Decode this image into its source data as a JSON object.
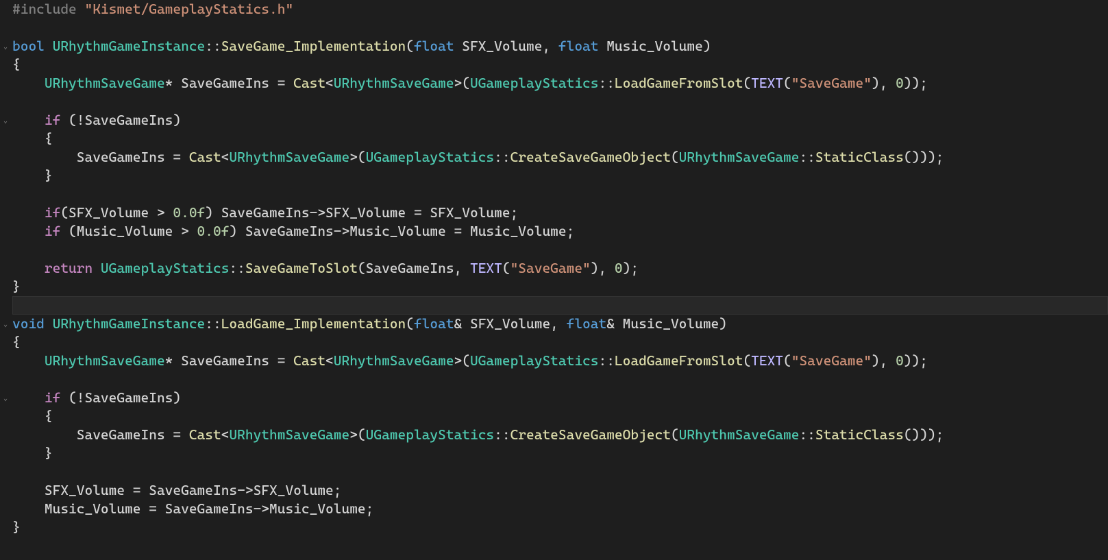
{
  "fold_marks": [
    {
      "line": 2,
      "glyph": "⌄"
    },
    {
      "line": 7,
      "glyph": "⌄"
    },
    {
      "line": 17,
      "glyph": "⌄"
    },
    {
      "line": 21,
      "glyph": "⌄"
    }
  ],
  "lines": [
    {
      "n": 1,
      "hl": false,
      "tokens": [
        [
          "d",
          "#include "
        ],
        [
          "s",
          "\"Kismet/GameplayStatics.h\""
        ]
      ]
    },
    {
      "n": 2,
      "hl": false,
      "tokens": [
        [
          "c",
          ""
        ]
      ]
    },
    {
      "n": 3,
      "hl": false,
      "tokens": [
        [
          "k",
          "bool "
        ],
        [
          "t",
          "URhythmGameInstance"
        ],
        [
          "p",
          "::"
        ],
        [
          "f",
          "SaveGame_Implementation"
        ],
        [
          "p",
          "("
        ],
        [
          "k",
          "float"
        ],
        [
          "c",
          " SFX_Volume"
        ],
        [
          "p",
          ", "
        ],
        [
          "k",
          "float"
        ],
        [
          "c",
          " Music_Volume"
        ],
        [
          "p",
          ")"
        ]
      ]
    },
    {
      "n": 4,
      "hl": false,
      "tokens": [
        [
          "p",
          "{"
        ]
      ]
    },
    {
      "n": 5,
      "hl": false,
      "tokens": [
        [
          "c",
          "    "
        ],
        [
          "t",
          "URhythmSaveGame"
        ],
        [
          "p",
          "* "
        ],
        [
          "c",
          "SaveGameIns "
        ],
        [
          "op",
          "= "
        ],
        [
          "f",
          "Cast"
        ],
        [
          "p",
          "<"
        ],
        [
          "t",
          "URhythmSaveGame"
        ],
        [
          "p",
          ">("
        ],
        [
          "t",
          "UGameplayStatics"
        ],
        [
          "p",
          "::"
        ],
        [
          "f",
          "LoadGameFromSlot"
        ],
        [
          "p",
          "("
        ],
        [
          "mac",
          "TEXT"
        ],
        [
          "p",
          "("
        ],
        [
          "s",
          "\"SaveGame\""
        ],
        [
          "p",
          "), "
        ],
        [
          "n",
          "0"
        ],
        [
          "p",
          "));"
        ]
      ]
    },
    {
      "n": 6,
      "hl": false,
      "tokens": [
        [
          "c",
          ""
        ]
      ]
    },
    {
      "n": 7,
      "hl": false,
      "tokens": [
        [
          "c",
          "    "
        ],
        [
          "m",
          "if"
        ],
        [
          "c",
          " "
        ],
        [
          "p",
          "(!"
        ],
        [
          "c",
          "SaveGameIns"
        ],
        [
          "p",
          ")"
        ]
      ]
    },
    {
      "n": 8,
      "hl": false,
      "tokens": [
        [
          "c",
          "    "
        ],
        [
          "p",
          "{"
        ]
      ]
    },
    {
      "n": 9,
      "hl": false,
      "tokens": [
        [
          "c",
          "        SaveGameIns "
        ],
        [
          "op",
          "= "
        ],
        [
          "f",
          "Cast"
        ],
        [
          "p",
          "<"
        ],
        [
          "t",
          "URhythmSaveGame"
        ],
        [
          "p",
          ">("
        ],
        [
          "t",
          "UGameplayStatics"
        ],
        [
          "p",
          "::"
        ],
        [
          "f",
          "CreateSaveGameObject"
        ],
        [
          "p",
          "("
        ],
        [
          "t",
          "URhythmSaveGame"
        ],
        [
          "p",
          "::"
        ],
        [
          "f",
          "StaticClass"
        ],
        [
          "p",
          "()));"
        ]
      ]
    },
    {
      "n": 10,
      "hl": false,
      "tokens": [
        [
          "c",
          "    "
        ],
        [
          "p",
          "}"
        ]
      ]
    },
    {
      "n": 11,
      "hl": false,
      "tokens": [
        [
          "c",
          ""
        ]
      ]
    },
    {
      "n": 12,
      "hl": false,
      "tokens": [
        [
          "c",
          "    "
        ],
        [
          "m",
          "if"
        ],
        [
          "p",
          "("
        ],
        [
          "c",
          "SFX_Volume "
        ],
        [
          "op",
          "> "
        ],
        [
          "n",
          "0.0f"
        ],
        [
          "p",
          ") "
        ],
        [
          "c",
          "SaveGameIns"
        ],
        [
          "op",
          "->"
        ],
        [
          "c",
          "SFX_Volume "
        ],
        [
          "op",
          "= "
        ],
        [
          "c",
          "SFX_Volume"
        ],
        [
          "p",
          ";"
        ]
      ]
    },
    {
      "n": 13,
      "hl": false,
      "tokens": [
        [
          "c",
          "    "
        ],
        [
          "m",
          "if"
        ],
        [
          "c",
          " "
        ],
        [
          "p",
          "("
        ],
        [
          "c",
          "Music_Volume "
        ],
        [
          "op",
          "> "
        ],
        [
          "n",
          "0.0f"
        ],
        [
          "p",
          ") "
        ],
        [
          "c",
          "SaveGameIns"
        ],
        [
          "op",
          "->"
        ],
        [
          "c",
          "Music_Volume "
        ],
        [
          "op",
          "= "
        ],
        [
          "c",
          "Music_Volume"
        ],
        [
          "p",
          ";"
        ]
      ]
    },
    {
      "n": 14,
      "hl": false,
      "tokens": [
        [
          "c",
          ""
        ]
      ]
    },
    {
      "n": 15,
      "hl": false,
      "tokens": [
        [
          "c",
          "    "
        ],
        [
          "m",
          "return"
        ],
        [
          "c",
          " "
        ],
        [
          "t",
          "UGameplayStatics"
        ],
        [
          "p",
          "::"
        ],
        [
          "f",
          "SaveGameToSlot"
        ],
        [
          "p",
          "("
        ],
        [
          "c",
          "SaveGameIns"
        ],
        [
          "p",
          ", "
        ],
        [
          "mac",
          "TEXT"
        ],
        [
          "p",
          "("
        ],
        [
          "s",
          "\"SaveGame\""
        ],
        [
          "p",
          "), "
        ],
        [
          "n",
          "0"
        ],
        [
          "p",
          ");"
        ]
      ]
    },
    {
      "n": 16,
      "hl": false,
      "tokens": [
        [
          "p",
          "}"
        ]
      ]
    },
    {
      "n": 17,
      "hl": true,
      "tokens": [
        [
          "c",
          ""
        ]
      ]
    },
    {
      "n": 18,
      "hl": false,
      "tokens": [
        [
          "k",
          "void "
        ],
        [
          "t",
          "URhythmGameInstance"
        ],
        [
          "p",
          "::"
        ],
        [
          "f",
          "LoadGame_Implementation"
        ],
        [
          "p",
          "("
        ],
        [
          "k",
          "float"
        ],
        [
          "p",
          "& "
        ],
        [
          "c",
          "SFX_Volume"
        ],
        [
          "p",
          ", "
        ],
        [
          "k",
          "float"
        ],
        [
          "p",
          "& "
        ],
        [
          "c",
          "Music_Volume"
        ],
        [
          "p",
          ")"
        ]
      ]
    },
    {
      "n": 19,
      "hl": false,
      "tokens": [
        [
          "p",
          "{"
        ]
      ]
    },
    {
      "n": 20,
      "hl": false,
      "tokens": [
        [
          "c",
          "    "
        ],
        [
          "t",
          "URhythmSaveGame"
        ],
        [
          "p",
          "* "
        ],
        [
          "c",
          "SaveGameIns "
        ],
        [
          "op",
          "= "
        ],
        [
          "f",
          "Cast"
        ],
        [
          "p",
          "<"
        ],
        [
          "t",
          "URhythmSaveGame"
        ],
        [
          "p",
          ">("
        ],
        [
          "t",
          "UGameplayStatics"
        ],
        [
          "p",
          "::"
        ],
        [
          "f",
          "LoadGameFromSlot"
        ],
        [
          "p",
          "("
        ],
        [
          "mac",
          "TEXT"
        ],
        [
          "p",
          "("
        ],
        [
          "s",
          "\"SaveGame\""
        ],
        [
          "p",
          "), "
        ],
        [
          "n",
          "0"
        ],
        [
          "p",
          "));"
        ]
      ]
    },
    {
      "n": 21,
      "hl": false,
      "tokens": [
        [
          "c",
          ""
        ]
      ]
    },
    {
      "n": 22,
      "hl": false,
      "tokens": [
        [
          "c",
          "    "
        ],
        [
          "m",
          "if"
        ],
        [
          "c",
          " "
        ],
        [
          "p",
          "(!"
        ],
        [
          "c",
          "SaveGameIns"
        ],
        [
          "p",
          ")"
        ]
      ]
    },
    {
      "n": 23,
      "hl": false,
      "tokens": [
        [
          "c",
          "    "
        ],
        [
          "p",
          "{"
        ]
      ]
    },
    {
      "n": 24,
      "hl": false,
      "tokens": [
        [
          "c",
          "        SaveGameIns "
        ],
        [
          "op",
          "= "
        ],
        [
          "f",
          "Cast"
        ],
        [
          "p",
          "<"
        ],
        [
          "t",
          "URhythmSaveGame"
        ],
        [
          "p",
          ">("
        ],
        [
          "t",
          "UGameplayStatics"
        ],
        [
          "p",
          "::"
        ],
        [
          "f",
          "CreateSaveGameObject"
        ],
        [
          "p",
          "("
        ],
        [
          "t",
          "URhythmSaveGame"
        ],
        [
          "p",
          "::"
        ],
        [
          "f",
          "StaticClass"
        ],
        [
          "p",
          "()));"
        ]
      ]
    },
    {
      "n": 25,
      "hl": false,
      "tokens": [
        [
          "c",
          "    "
        ],
        [
          "p",
          "}"
        ]
      ]
    },
    {
      "n": 26,
      "hl": false,
      "tokens": [
        [
          "c",
          ""
        ]
      ]
    },
    {
      "n": 27,
      "hl": false,
      "tokens": [
        [
          "c",
          "    SFX_Volume "
        ],
        [
          "op",
          "= "
        ],
        [
          "c",
          "SaveGameIns"
        ],
        [
          "op",
          "->"
        ],
        [
          "c",
          "SFX_Volume"
        ],
        [
          "p",
          ";"
        ]
      ]
    },
    {
      "n": 28,
      "hl": false,
      "tokens": [
        [
          "c",
          "    Music_Volume "
        ],
        [
          "op",
          "= "
        ],
        [
          "c",
          "SaveGameIns"
        ],
        [
          "op",
          "->"
        ],
        [
          "c",
          "Music_Volume"
        ],
        [
          "p",
          ";"
        ]
      ]
    },
    {
      "n": 29,
      "hl": false,
      "tokens": [
        [
          "p",
          "}"
        ]
      ]
    }
  ]
}
